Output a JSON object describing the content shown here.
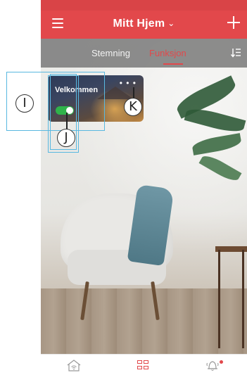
{
  "app": {
    "title": "Mitt Hjem",
    "title_chevron": "⌄",
    "accent_color": "#e2484b",
    "toggle_color": "#2fb34a"
  },
  "header": {
    "menu_icon": "hamburger-icon",
    "add_icon": "plus-icon"
  },
  "tabs": [
    {
      "label": "Stemning",
      "active": false
    },
    {
      "label": "Funksjon",
      "active": true
    }
  ],
  "sort_icon": "sort-icon",
  "card": {
    "title": "Velkommen",
    "menu": "• • •",
    "toggle_on": true
  },
  "bottom_nav": [
    {
      "icon": "home-wifi-icon",
      "active": false
    },
    {
      "icon": "grid-icon",
      "active": true
    },
    {
      "icon": "bell-icon",
      "active": false,
      "badge": true
    }
  ],
  "annotations": [
    {
      "label": "I"
    },
    {
      "label": "J"
    },
    {
      "label": "K"
    }
  ]
}
